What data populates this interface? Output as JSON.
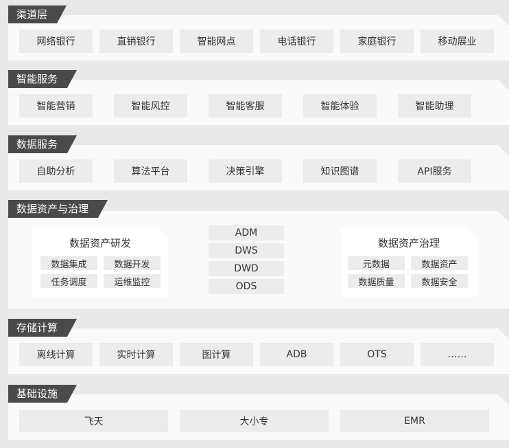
{
  "layers": {
    "channel": {
      "title": "渠道层",
      "items": [
        "网络银行",
        "直销银行",
        "智能网点",
        "电话银行",
        "家庭银行",
        "移动展业"
      ]
    },
    "smart": {
      "title": "智能服务",
      "items": [
        "智能营销",
        "智能风控",
        "智能客服",
        "智能体验",
        "智能助理"
      ]
    },
    "data_service": {
      "title": "数据服务",
      "items": [
        "自助分析",
        "算法平台",
        "决策引擎",
        "知识图谱",
        "API服务"
      ]
    },
    "governance": {
      "title": "数据资产与治理",
      "dev": {
        "title": "数据资产研发",
        "items": [
          "数据集成",
          "数据开发",
          "任务调度",
          "运维监控"
        ]
      },
      "tiers": [
        "ADM",
        "DWS",
        "DWD",
        "ODS"
      ],
      "gov": {
        "title": "数据资产治理",
        "items": [
          "元数据",
          "数据资产",
          "数据质量",
          "数据安全"
        ]
      }
    },
    "compute": {
      "title": "存储计算",
      "items": [
        "离线计算",
        "实时计算",
        "图计算",
        "ADB",
        "OTS",
        "……"
      ]
    },
    "infra": {
      "title": "基础设施",
      "items": [
        "飞天",
        "大小专",
        "EMR"
      ]
    }
  }
}
